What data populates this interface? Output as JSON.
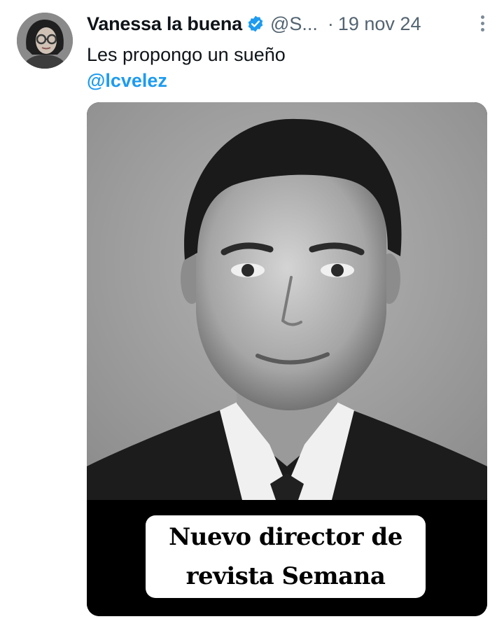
{
  "post": {
    "display_name": "Vanessa la buena",
    "handle": "@S...",
    "separator": "·",
    "date": "19 nov 24",
    "text": "Les propongo un sueño",
    "mention": "@lcvelez"
  },
  "icons": {
    "verified": "verified-badge-icon",
    "more": "more-options-icon"
  },
  "media": {
    "caption_line1": "Nuevo director de",
    "caption_line2": "revista Semana"
  },
  "colors": {
    "link": "#1d9bf0",
    "secondary_text": "#536471",
    "primary_text": "#0f1419"
  }
}
